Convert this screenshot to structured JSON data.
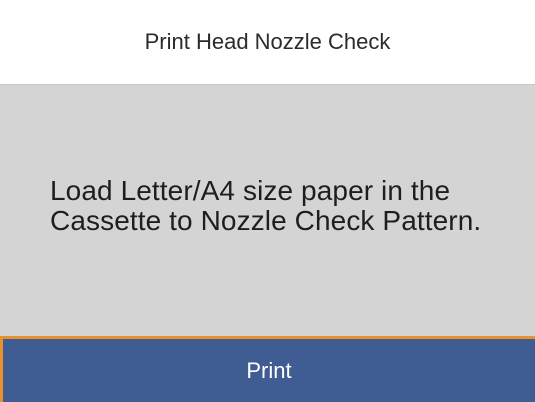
{
  "header": {
    "title": "Print Head Nozzle Check"
  },
  "message": {
    "text": "Load Letter/A4 size paper in the\nCassette to Nozzle Check Pattern."
  },
  "footer": {
    "print_label": "Print"
  },
  "colors": {
    "button_background": "#3f5d93",
    "button_highlight": "#e8912f",
    "message_background": "#d4d4d4"
  }
}
